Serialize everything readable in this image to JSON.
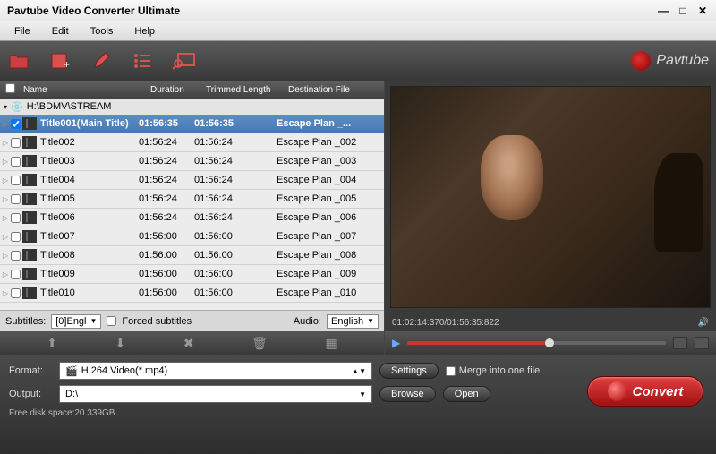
{
  "title": "Pavtube Video Converter Ultimate",
  "menu": [
    "File",
    "Edit",
    "Tools",
    "Help"
  ],
  "brand": "Pavtube",
  "columns": {
    "name": "Name",
    "duration": "Duration",
    "trimmed": "Trimmed Length",
    "dest": "Destination File"
  },
  "source": "H:\\BDMV\\STREAM",
  "rows": [
    {
      "name": "Title001(Main Title)",
      "dur": "01:56:35",
      "trim": "01:56:35",
      "dest": "Escape Plan _...",
      "checked": true,
      "selected": true
    },
    {
      "name": "Title002",
      "dur": "01:56:24",
      "trim": "01:56:24",
      "dest": "Escape Plan _002"
    },
    {
      "name": "Title003",
      "dur": "01:56:24",
      "trim": "01:56:24",
      "dest": "Escape Plan _003"
    },
    {
      "name": "Title004",
      "dur": "01:56:24",
      "trim": "01:56:24",
      "dest": "Escape Plan _004"
    },
    {
      "name": "Title005",
      "dur": "01:56:24",
      "trim": "01:56:24",
      "dest": "Escape Plan _005"
    },
    {
      "name": "Title006",
      "dur": "01:56:24",
      "trim": "01:56:24",
      "dest": "Escape Plan _006"
    },
    {
      "name": "Title007",
      "dur": "01:56:00",
      "trim": "01:56:00",
      "dest": "Escape Plan _007"
    },
    {
      "name": "Title008",
      "dur": "01:56:00",
      "trim": "01:56:00",
      "dest": "Escape Plan _008"
    },
    {
      "name": "Title009",
      "dur": "01:56:00",
      "trim": "01:56:00",
      "dest": "Escape Plan _009"
    },
    {
      "name": "Title010",
      "dur": "01:56:00",
      "trim": "01:56:00",
      "dest": "Escape Plan _010"
    }
  ],
  "subtitles": {
    "label": "Subtitles:",
    "value": "[0]Engl",
    "forced": "Forced subtitles"
  },
  "audio": {
    "label": "Audio:",
    "value": "English"
  },
  "playback": {
    "time": "01:02:14:370/01:56:35:822"
  },
  "format": {
    "label": "Format:",
    "value": "H.264 Video(*.mp4)"
  },
  "output": {
    "label": "Output:",
    "value": "D:\\"
  },
  "buttons": {
    "settings": "Settings",
    "browse": "Browse",
    "open": "Open",
    "convert": "Convert"
  },
  "merge": "Merge into one file",
  "disk": "Free disk space:20.339GB"
}
